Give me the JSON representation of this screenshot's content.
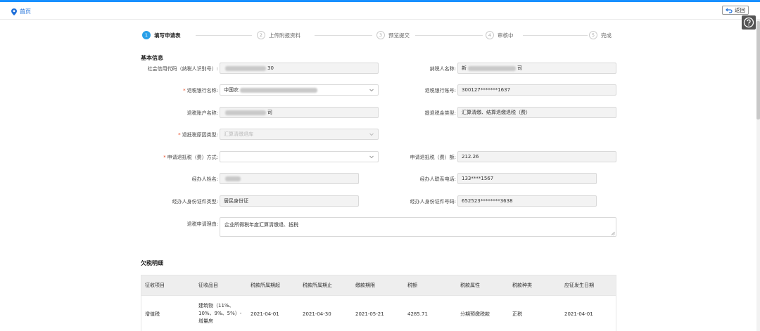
{
  "topbar": {
    "home_label": "首页",
    "back_label": "返回"
  },
  "steps": [
    {
      "num": "1",
      "label": "填写申请表",
      "active": true
    },
    {
      "num": "2",
      "label": "上传附报资料",
      "active": false
    },
    {
      "num": "3",
      "label": "预览提交",
      "active": false
    },
    {
      "num": "4",
      "label": "审核中",
      "active": false
    },
    {
      "num": "5",
      "label": "完成",
      "active": false
    }
  ],
  "basic": {
    "title": "基本信息",
    "credit_code_label": "社会信用代码（纳税人识别号）:",
    "credit_code_value": "30",
    "taxpayer_name_label": "纳税人名称:",
    "taxpayer_name_prefix": "新",
    "taxpayer_name_suffix": "司",
    "refund_bank_label": "退税银行名称:",
    "refund_bank_value": "中国农",
    "refund_account_label": "退税银行账号:",
    "refund_account_value": "300127*******1637",
    "account_name_label": "退税账户名称:",
    "account_name_suffix": "司",
    "refund_type_label": "提退税金类型:",
    "refund_type_value": "汇算清缴、结算退缴退税（费）",
    "reason_type_label": "退抵税原因类型:",
    "reason_type_placeholder": "汇算清缴退库",
    "method_label": "申请退抵税（费）方式:",
    "amount_label": "申请退抵税（费）额:",
    "amount_value": "212.26",
    "handler_name_label": "经办人姓名:",
    "handler_phone_label": "经办人联系电话:",
    "handler_phone_value": "133****1567",
    "id_type_label": "经办人身份证件类型:",
    "id_type_value": "居民身份证",
    "id_number_label": "经办人身份证件号码:",
    "id_number_value": "652523********3638",
    "reason_label": "退税申请理由:",
    "reason_value": "企业所得税年度汇算清缴退、抵税"
  },
  "arrears": {
    "title": "欠税明细",
    "headers": [
      "征收项目",
      "征收品目",
      "税款所属期起",
      "税款所属期止",
      "缴款期限",
      "税额",
      "税款属性",
      "税款种类",
      "应征发生日期"
    ],
    "rows": [
      [
        "增值税",
        "建筑物（11%、10%、9%、5%）-增量房",
        "2021-04-01",
        "2021-04-30",
        "2021-05-21",
        "4285.71",
        "分期预缴税款",
        "正税",
        "2021-04-01"
      ]
    ]
  }
}
